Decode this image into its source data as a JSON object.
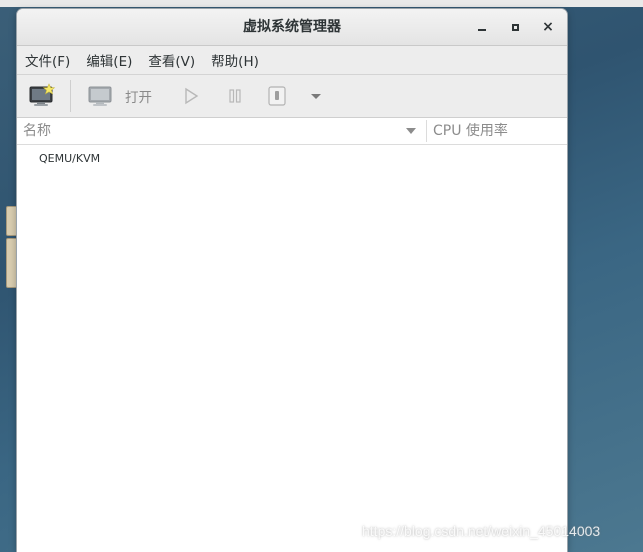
{
  "window": {
    "title": "虚拟系统管理器",
    "close_glyph": "×"
  },
  "menubar": {
    "items": [
      "文件(F)",
      "编辑(E)",
      "查看(V)",
      "帮助(H)"
    ]
  },
  "toolbar": {
    "new_vm_icon": "monitor-star-icon",
    "open_icon": "monitor-icon",
    "open_label": "打开",
    "run_icon": "play-icon",
    "pause_icon": "pause-icon",
    "shutdown_icon": "power-icon",
    "more_icon": "chevron-down-icon"
  },
  "columns": {
    "name": "名称",
    "cpu": "CPU 使用率"
  },
  "connections": [
    {
      "name": "QEMU/KVM"
    }
  ],
  "watermark": "https://blog.csdn.net/weixin_45014003",
  "colors": {
    "desktop": "#3a6683",
    "window_chrome": "#ededed",
    "disabled_text": "#8a8a8a"
  }
}
